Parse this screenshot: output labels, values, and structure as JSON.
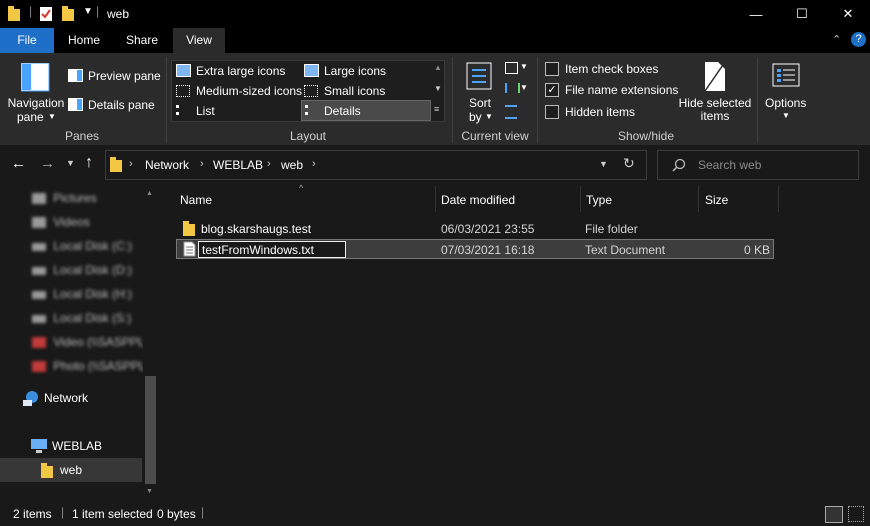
{
  "window": {
    "title": "web",
    "minimize_glyph": "—",
    "maximize_glyph": "☐",
    "close_glyph": "✕"
  },
  "ribbon_tabs": [
    {
      "label": "File"
    },
    {
      "label": "Home"
    },
    {
      "label": "Share"
    },
    {
      "label": "View"
    }
  ],
  "ribbon": {
    "panes": {
      "navigation_pane": "Navigation",
      "navigation_pane_2": "pane",
      "preview_pane": "Preview pane",
      "details_pane": "Details pane",
      "group_label": "Panes"
    },
    "layout": {
      "items": [
        "Extra large icons",
        "Large icons",
        "Medium-sized icons",
        "Small icons",
        "List",
        "Details"
      ],
      "selected": "Details",
      "group_label": "Layout"
    },
    "current_view": {
      "sort_by": "Sort",
      "sort_by_2": "by",
      "group_label": "Current view"
    },
    "show_hide": {
      "item_check_boxes": "Item check boxes",
      "file_name_extensions": "File name extensions",
      "hidden_items": "Hidden items",
      "item_check_boxes_checked": false,
      "file_name_extensions_checked": true,
      "hidden_items_checked": false,
      "hide_selected": "Hide selected",
      "hide_selected_2": "items",
      "group_label": "Show/hide"
    },
    "options": {
      "label": "Options"
    }
  },
  "address": {
    "crumbs": [
      "Network",
      "WEBLAB",
      "web"
    ],
    "search_placeholder": "Search web"
  },
  "nav_pane": {
    "blurred_items": [
      "Pictures",
      "Videos",
      "Local Disk (C:)",
      "Local Disk (D:)",
      "Local Disk (H:)",
      "Local Disk (S:)",
      "Video (\\\\SASPPL",
      "Photo (\\\\SASPPL"
    ],
    "network": "Network",
    "weblab": "WEBLAB",
    "web": "web"
  },
  "columns": {
    "name": "Name",
    "date_modified": "Date modified",
    "type": "Type",
    "size": "Size"
  },
  "files": [
    {
      "name": "blog.skarshaugs.test",
      "date": "06/03/2021 23:55",
      "type": "File folder",
      "size": ""
    },
    {
      "name": "testFromWindows.txt",
      "date": "07/03/2021 16:18",
      "type": "Text Document",
      "size": "0 KB",
      "renaming": true
    }
  ],
  "status": {
    "count": "2 items",
    "selected": "1 item selected",
    "size": "0 bytes"
  },
  "colors": {
    "file_tab": "#1d6fc8",
    "folder": "#f2c744",
    "selection": "#3d3d3d",
    "accent_blue": "#4aa3ff"
  },
  "icons": [
    "folder-icon",
    "document-icon",
    "network-icon",
    "computer-icon",
    "checkbox-icon",
    "search-icon"
  ]
}
